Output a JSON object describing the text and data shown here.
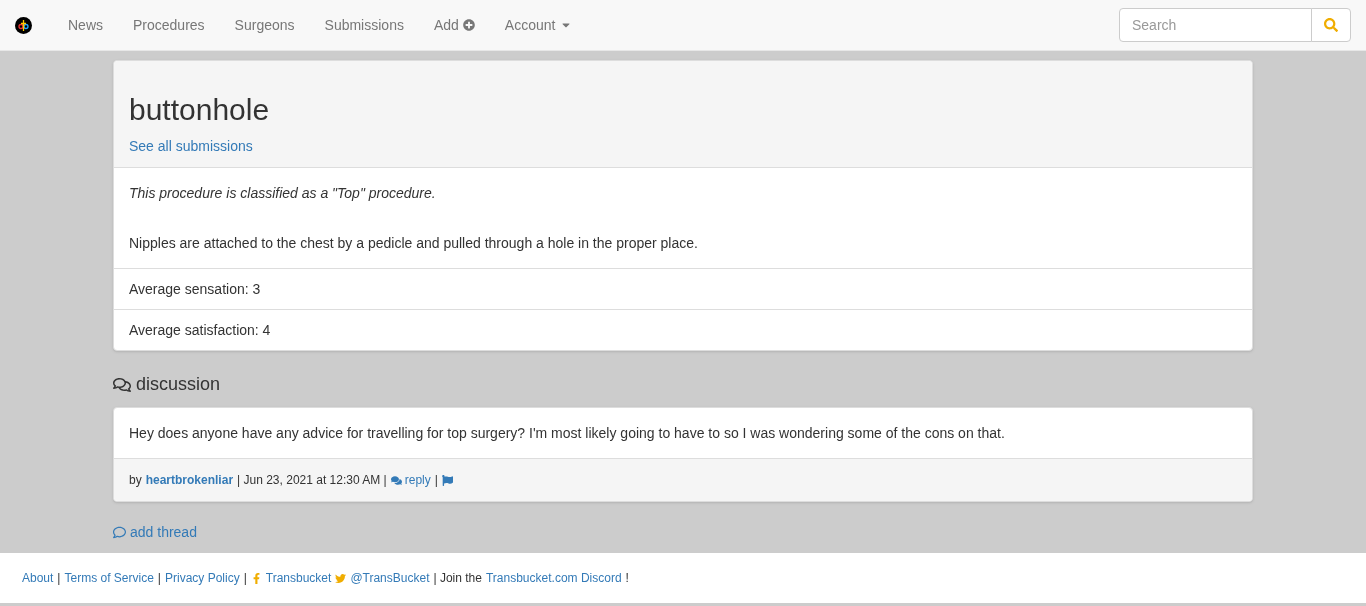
{
  "nav": {
    "items": [
      {
        "label": "News",
        "kind": "link"
      },
      {
        "label": "Procedures",
        "kind": "link"
      },
      {
        "label": "Surgeons",
        "kind": "link"
      },
      {
        "label": "Submissions",
        "kind": "link"
      },
      {
        "label": "Add",
        "kind": "add"
      },
      {
        "label": "Account",
        "kind": "dropdown"
      }
    ],
    "search": {
      "placeholder": "Search"
    }
  },
  "procedure": {
    "title": "buttonhole",
    "link": "See all submissions",
    "classification": "This procedure is classified as a \"Top\" procedure.",
    "description": "Nipples are attached to the chest by a pedicle and pulled through a hole in the proper place.",
    "stats": [
      "Average sensation: 3",
      "Average satisfaction: 4"
    ]
  },
  "discussion": {
    "heading": "discussion",
    "threads": [
      {
        "body": "Hey does anyone have any advice for travelling for top surgery? I'm most likely going to have to so I was wondering some of the cons on that.",
        "by": "by",
        "author": "heartbrokenliar",
        "date": "| Jun 23, 2021 at 12:30 AM |",
        "reply": "reply",
        "sep": "|"
      }
    ],
    "add": "add thread"
  },
  "footer": [
    {
      "kind": "link",
      "text": "About"
    },
    {
      "kind": "text",
      "text": "|"
    },
    {
      "kind": "link",
      "text": "Terms of Service"
    },
    {
      "kind": "text",
      "text": "|"
    },
    {
      "kind": "link",
      "text": "Privacy Policy"
    },
    {
      "kind": "text",
      "text": "|"
    },
    {
      "kind": "facebook",
      "text": "Transbucket"
    },
    {
      "kind": "twitter",
      "text": "@TransBucket"
    },
    {
      "kind": "text",
      "text": "| Join the"
    },
    {
      "kind": "link",
      "text": "Transbucket.com Discord"
    },
    {
      "kind": "text",
      "text": "!"
    }
  ]
}
